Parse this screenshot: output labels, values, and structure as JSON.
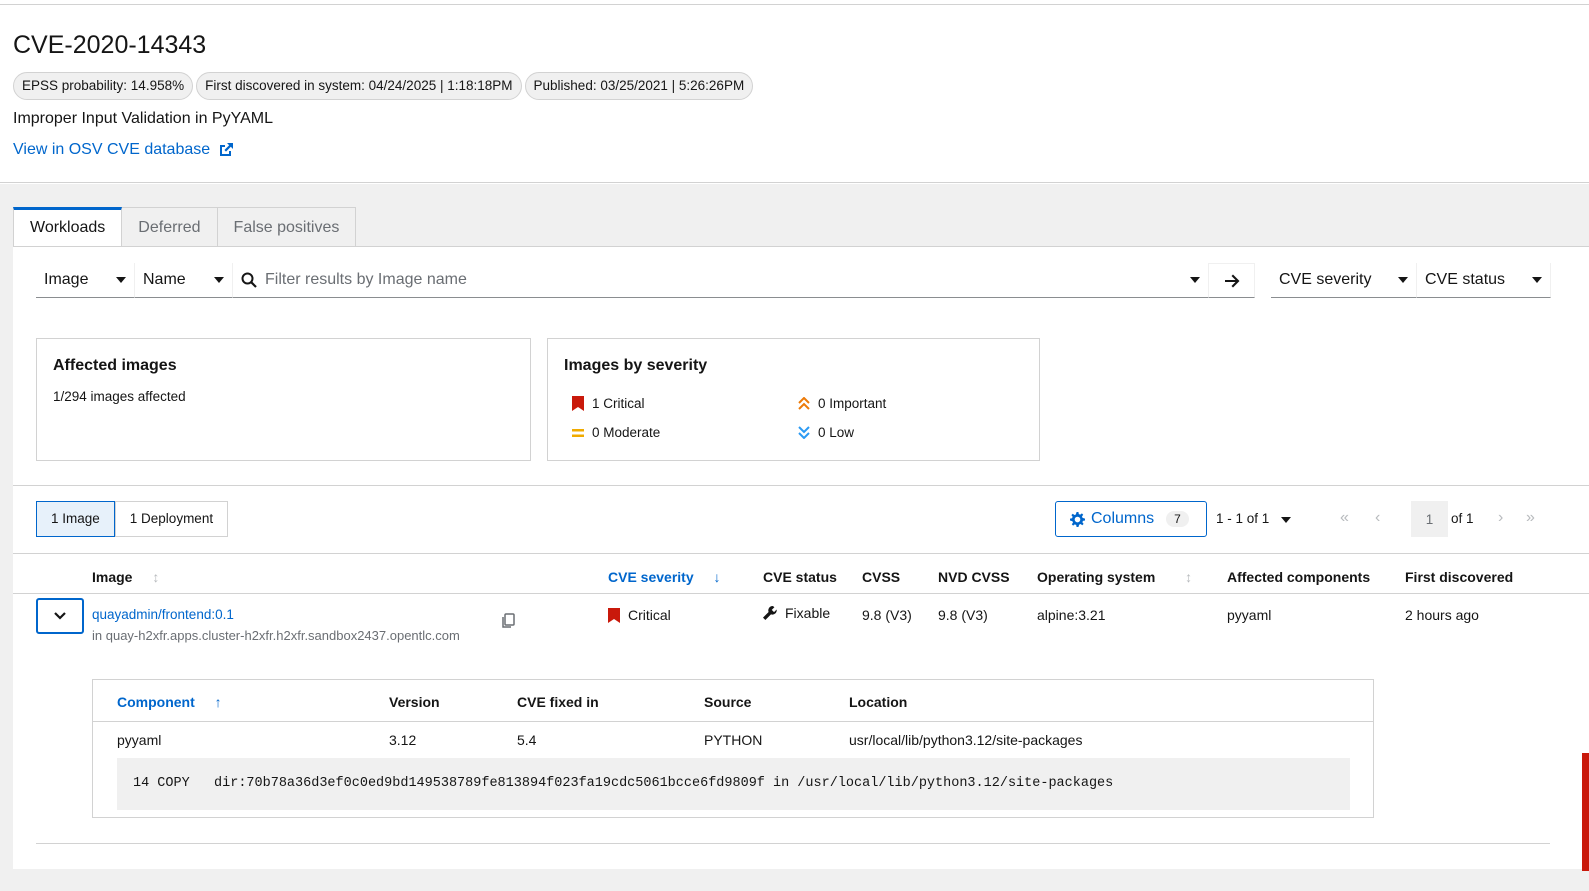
{
  "cve": {
    "title": "CVE-2020-14343",
    "labels": [
      "EPSS probability: 14.958%",
      "First discovered in system: 04/24/2025 | 1:18:18PM",
      "Published: 03/25/2021 | 5:26:26PM"
    ],
    "description": "Improper Input Validation in PyYAML",
    "osv_link": "View in OSV CVE database"
  },
  "tabs": [
    "Workloads",
    "Deferred",
    "False positives"
  ],
  "toolbar": {
    "entity_select": "Image",
    "attribute_select": "Name",
    "search_placeholder": "Filter results by Image name",
    "severity_filter": "CVE severity",
    "status_filter": "CVE status"
  },
  "affected_card": {
    "title": "Affected images",
    "text": "1/294 images affected"
  },
  "severity_card": {
    "title": "Images by severity",
    "critical": "1 Critical",
    "important": "0 Important",
    "moderate": "0 Moderate",
    "low": "0 Low"
  },
  "colors": {
    "critical": "#c9190b",
    "important": "#ec7a08",
    "moderate": "#f0ab00",
    "low": "#2b9af3",
    "link": "#0066cc"
  },
  "entity_toggle": {
    "images": "1 Image",
    "deployments": "1 Deployment"
  },
  "columns_button": {
    "label": "Columns",
    "count": "7"
  },
  "pagination": {
    "range": "1 - 1 of 1",
    "page": "1",
    "of": "of 1"
  },
  "table": {
    "headers": [
      "Image",
      "CVE severity",
      "CVE status",
      "CVSS",
      "NVD CVSS",
      "Operating system",
      "Affected components",
      "First discovered"
    ],
    "row": {
      "image": "quayadmin/frontend:0.1",
      "registry": "in quay-h2xfr.apps.cluster-h2xfr.h2xfr.sandbox2437.opentlc.com",
      "severity": "Critical",
      "status": "Fixable",
      "cvss": "9.8 (V3)",
      "nvd_cvss": "9.8 (V3)",
      "os": "alpine:3.21",
      "components": "pyyaml",
      "first_discovered": "2 hours ago"
    }
  },
  "component_table": {
    "headers": [
      "Component",
      "Version",
      "CVE fixed in",
      "Source",
      "Location"
    ],
    "row": {
      "component": "pyyaml",
      "version": "3.12",
      "fixed_in": "5.4",
      "source": "PYTHON",
      "location": "usr/local/lib/python3.12/site-packages"
    },
    "layer": "14 COPY   dir:70b78a36d3ef0c0ed9bd149538789fe813894f023fa19cdc5061bcce6fd9809f in /usr/local/lib/python3.12/site-packages"
  }
}
